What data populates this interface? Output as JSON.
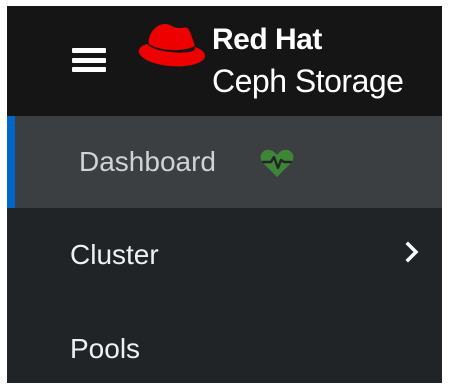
{
  "header": {
    "menu_icon": "hamburger-menu-icon",
    "logo_icon": "red-hat-fedora-icon",
    "brand_line1": "Red Hat",
    "brand_line2": "Ceph Storage"
  },
  "nav": {
    "items": [
      {
        "label": "Dashboard",
        "active": true,
        "icon": "heartbeat-icon",
        "icon_color": "#3e8635"
      },
      {
        "label": "Cluster",
        "active": false,
        "icon": "chevron-right-icon"
      },
      {
        "label": "Pools",
        "active": false
      }
    ]
  },
  "colors": {
    "header_bg": "#151515",
    "sidebar_bg": "#212427",
    "active_bg": "#3c3f42",
    "active_indicator": "#0066cc",
    "brand_red": "#ee0000",
    "health_green": "#3e8635"
  }
}
